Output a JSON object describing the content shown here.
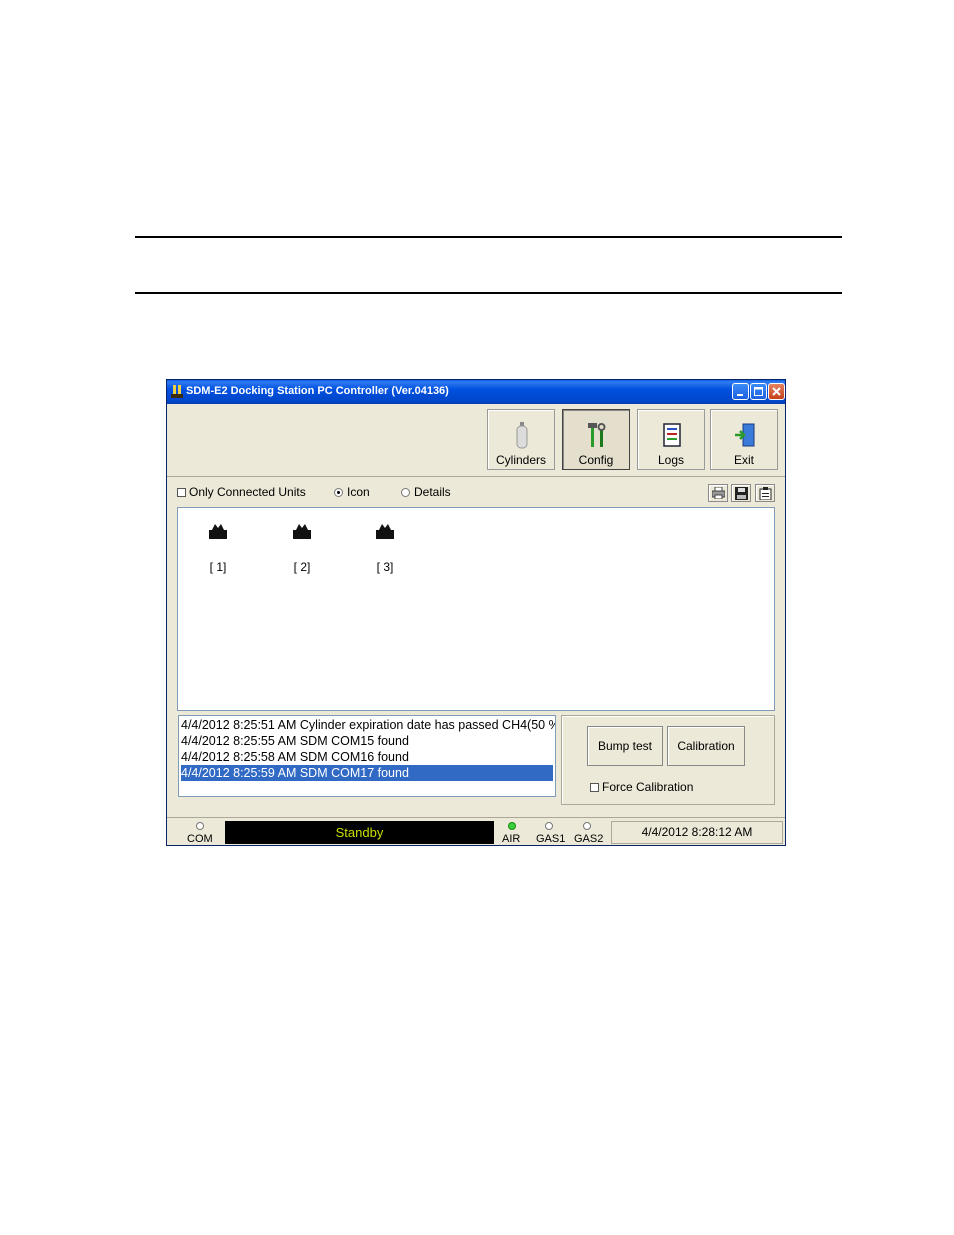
{
  "window": {
    "title": "SDM-E2 Docking Station PC Controller (Ver.04136)"
  },
  "toolbar": {
    "buttons": [
      {
        "label": "Cylinders",
        "icon": "cylinder-icon"
      },
      {
        "label": "Config",
        "icon": "tools-icon",
        "pressed": true
      },
      {
        "label": "Logs",
        "icon": "logbook-icon"
      },
      {
        "label": "Exit",
        "icon": "exit-door-icon"
      }
    ]
  },
  "options": {
    "only_connected_label": "Only Connected Units",
    "only_connected_checked": false,
    "view_icon_label": "Icon",
    "view_details_label": "Details",
    "view_selected": "Icon"
  },
  "units": [
    {
      "label": "[ 1]"
    },
    {
      "label": "[ 2]"
    },
    {
      "label": "[ 3]"
    }
  ],
  "log": [
    {
      "text": "4/4/2012 8:25:51 AM Cylinder expiration date has passed  CH4(50 %",
      "selected": false
    },
    {
      "text": "4/4/2012 8:25:55 AM SDM COM15 found",
      "selected": false
    },
    {
      "text": "4/4/2012 8:25:58 AM SDM COM16 found",
      "selected": false
    },
    {
      "text": "4/4/2012 8:25:59 AM SDM COM17 found",
      "selected": true
    }
  ],
  "actions": {
    "bump_test_label": "Bump test",
    "calibration_label": "Calibration",
    "force_calibration_label": "Force Calibration",
    "force_calibration_checked": false
  },
  "status": {
    "com_label": "COM",
    "display_text": "Standby",
    "air_label": "AIR",
    "gas1_label": "GAS1",
    "gas2_label": "GAS2",
    "air_on": true,
    "datetime": "4/4/2012 8:28:12 AM"
  },
  "colors": {
    "titlebar": "#0050e0",
    "selection": "#316ac5",
    "display_text": "#c8e000",
    "led_on": "#3bd03b"
  }
}
